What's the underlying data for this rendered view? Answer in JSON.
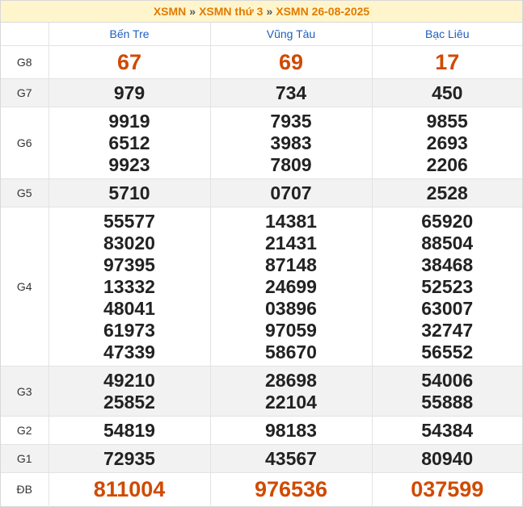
{
  "breadcrumb": {
    "item1": "XSMN",
    "item2": "XSMN thứ 3",
    "item3": "XSMN 26-08-2025",
    "separator": "»"
  },
  "provinces": [
    "Bến Tre",
    "Vũng Tàu",
    "Bạc Liêu"
  ],
  "rows": [
    {
      "label": "G8",
      "values": [
        [
          "67"
        ],
        [
          "69"
        ],
        [
          "17"
        ]
      ]
    },
    {
      "label": "G7",
      "values": [
        [
          "979"
        ],
        [
          "734"
        ],
        [
          "450"
        ]
      ]
    },
    {
      "label": "G6",
      "values": [
        [
          "9919",
          "6512",
          "9923"
        ],
        [
          "7935",
          "3983",
          "7809"
        ],
        [
          "9855",
          "2693",
          "2206"
        ]
      ]
    },
    {
      "label": "G5",
      "values": [
        [
          "5710"
        ],
        [
          "0707"
        ],
        [
          "2528"
        ]
      ]
    },
    {
      "label": "G4",
      "values": [
        [
          "55577",
          "83020",
          "97395",
          "13332",
          "48041",
          "61973",
          "47339"
        ],
        [
          "14381",
          "21431",
          "87148",
          "24699",
          "03896",
          "97059",
          "58670"
        ],
        [
          "65920",
          "88504",
          "38468",
          "52523",
          "63007",
          "32747",
          "56552"
        ]
      ]
    },
    {
      "label": "G3",
      "values": [
        [
          "49210",
          "25852"
        ],
        [
          "28698",
          "22104"
        ],
        [
          "54006",
          "55888"
        ]
      ]
    },
    {
      "label": "G2",
      "values": [
        [
          "54819"
        ],
        [
          "98183"
        ],
        [
          "54384"
        ]
      ]
    },
    {
      "label": "G1",
      "values": [
        [
          "72935"
        ],
        [
          "43567"
        ],
        [
          "80940"
        ]
      ]
    },
    {
      "label": "ĐB",
      "values": [
        [
          "811004"
        ],
        [
          "976536"
        ],
        [
          "037599"
        ]
      ]
    }
  ],
  "colors": {
    "header_bg": "#fff5cc",
    "header_text": "#e07b00",
    "province_text": "#1f5fbf",
    "highlight_number": "#d04a00",
    "alt_row_bg": "#f2f2f2"
  }
}
